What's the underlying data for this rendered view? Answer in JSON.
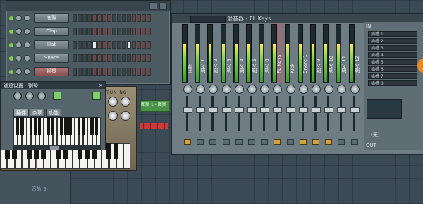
{
  "stepseq": {
    "channels": [
      {
        "name": "底鼓",
        "active": false,
        "steps": [
          0,
          0,
          0,
          0,
          0,
          0,
          0,
          0,
          0,
          0,
          0,
          0,
          0,
          0,
          0,
          0
        ]
      },
      {
        "name": "Clap",
        "active": false,
        "steps": [
          0,
          0,
          0,
          0,
          0,
          0,
          0,
          0,
          0,
          0,
          0,
          0,
          0,
          0,
          0,
          0
        ]
      },
      {
        "name": "Hat",
        "active": false,
        "steps": [
          0,
          0,
          0,
          0,
          1,
          0,
          0,
          0,
          0,
          0,
          0,
          1,
          0,
          0,
          0,
          0
        ]
      },
      {
        "name": "Snare",
        "active": false,
        "steps": [
          0,
          0,
          0,
          0,
          0,
          0,
          0,
          0,
          0,
          0,
          0,
          0,
          0,
          0,
          0,
          0
        ]
      },
      {
        "name": "钢琴",
        "active": true,
        "steps": [
          0,
          0,
          0,
          0,
          0,
          0,
          0,
          0,
          0,
          0,
          0,
          0,
          0,
          0,
          0,
          0
        ]
      }
    ]
  },
  "channel_settings": {
    "title": "通道设置 - 钢琴",
    "tabs": [
      "插件",
      "杂项",
      "功能"
    ],
    "selected_tab": 0
  },
  "piano_plugin": {
    "logo": "FL",
    "tuning_label": "TUNING"
  },
  "playlist": {
    "pattern_clip": "图案 1 - 图案",
    "track_label": "音轨 9"
  },
  "mixer": {
    "title": "混音器 - FL Keys",
    "tracks": [
      "主控",
      "插入 1",
      "插入 2",
      "插入 3",
      "插入 4",
      "插入 5",
      "插入 6",
      "FL Keys",
      "Kick",
      "Snare 1",
      "插入 9",
      "插入 10",
      "插入 11",
      "插入 12"
    ],
    "selected_track": 7,
    "input_label": "IN",
    "output_label": "OUT",
    "fx_slots": [
      "插槽 1",
      "插槽 2",
      "插槽 3",
      "插槽 4",
      "插槽 5",
      "插槽 6",
      "插槽 7",
      "插槽 8"
    ],
    "fx_none_label": "(无)"
  },
  "colors": {
    "accent": "#e88a2a",
    "meter_green": "#7cd44a",
    "selected_track": "#8e6f7a"
  }
}
